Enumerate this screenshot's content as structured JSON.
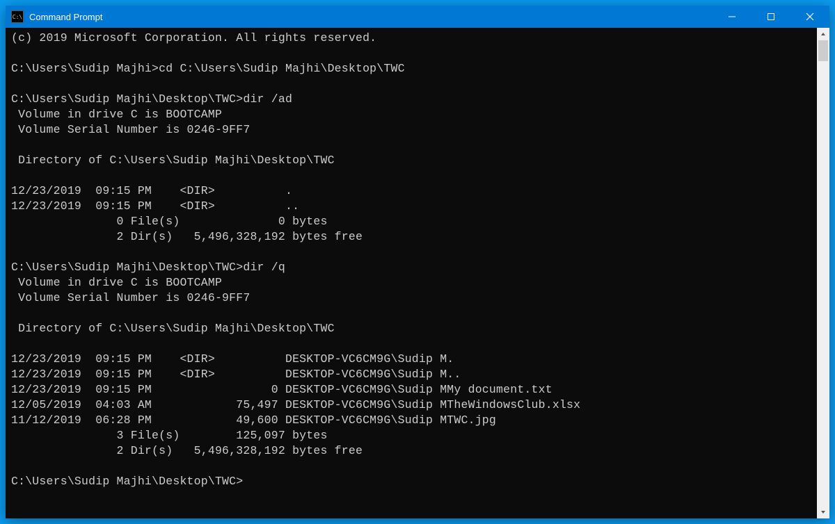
{
  "window": {
    "title": "Command Prompt",
    "icon_label": "C:\\"
  },
  "terminal": {
    "lines": [
      "(c) 2019 Microsoft Corporation. All rights reserved.",
      "",
      "C:\\Users\\Sudip Majhi>cd C:\\Users\\Sudip Majhi\\Desktop\\TWC",
      "",
      "C:\\Users\\Sudip Majhi\\Desktop\\TWC>dir /ad",
      " Volume in drive C is BOOTCAMP",
      " Volume Serial Number is 0246-9FF7",
      "",
      " Directory of C:\\Users\\Sudip Majhi\\Desktop\\TWC",
      "",
      "12/23/2019  09:15 PM    <DIR>          .",
      "12/23/2019  09:15 PM    <DIR>          ..",
      "               0 File(s)              0 bytes",
      "               2 Dir(s)   5,496,328,192 bytes free",
      "",
      "C:\\Users\\Sudip Majhi\\Desktop\\TWC>dir /q",
      " Volume in drive C is BOOTCAMP",
      " Volume Serial Number is 0246-9FF7",
      "",
      " Directory of C:\\Users\\Sudip Majhi\\Desktop\\TWC",
      "",
      "12/23/2019  09:15 PM    <DIR>          DESKTOP-VC6CM9G\\Sudip M.",
      "12/23/2019  09:15 PM    <DIR>          DESKTOP-VC6CM9G\\Sudip M..",
      "12/23/2019  09:15 PM                 0 DESKTOP-VC6CM9G\\Sudip MMy document.txt",
      "12/05/2019  04:03 AM            75,497 DESKTOP-VC6CM9G\\Sudip MTheWindowsClub.xlsx",
      "11/12/2019  06:28 PM            49,600 DESKTOP-VC6CM9G\\Sudip MTWC.jpg",
      "               3 File(s)        125,097 bytes",
      "               2 Dir(s)   5,496,328,192 bytes free",
      "",
      "C:\\Users\\Sudip Majhi\\Desktop\\TWC>"
    ]
  }
}
